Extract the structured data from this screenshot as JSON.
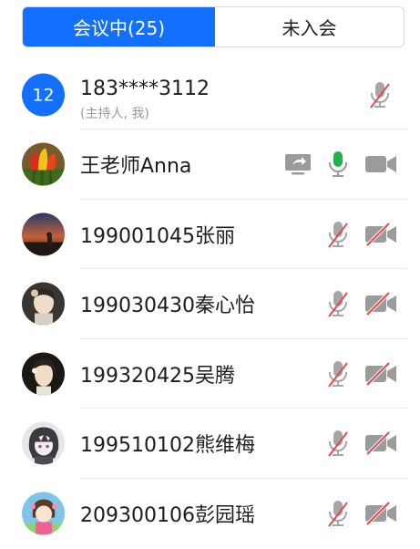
{
  "tabs": {
    "in_meeting": "会议中(25)",
    "not_joined": "未入会"
  },
  "participants": [
    {
      "name": "183****3112",
      "sub": "(主持人, 我)",
      "avatar_text": "12",
      "avatar_color": "#1370ff",
      "mic": "muted",
      "video": "none",
      "sharing": false
    },
    {
      "name": "王老师Anna",
      "avatar": "tulip-photo",
      "mic": "on",
      "video": "off",
      "sharing": true
    },
    {
      "name": "199001045张丽",
      "avatar": "sunset-photo",
      "mic": "muted",
      "video": "muted"
    },
    {
      "name": "199030430秦心怡",
      "avatar": "girl-photo",
      "mic": "muted",
      "video": "muted"
    },
    {
      "name": "199320425吴腾",
      "avatar": "girl-photo",
      "mic": "muted",
      "video": "muted"
    },
    {
      "name": "199510102熊维梅",
      "avatar": "anime-photo",
      "mic": "muted",
      "video": "muted"
    },
    {
      "name": "209300106彭园瑶",
      "avatar": "cartoon-photo",
      "mic": "muted",
      "video": "muted"
    }
  ],
  "colors": {
    "accent": "#1370ff",
    "mic_on": "#22b14c",
    "muted_slash": "#e5484d",
    "icon_gray": "#9b9b9b"
  }
}
